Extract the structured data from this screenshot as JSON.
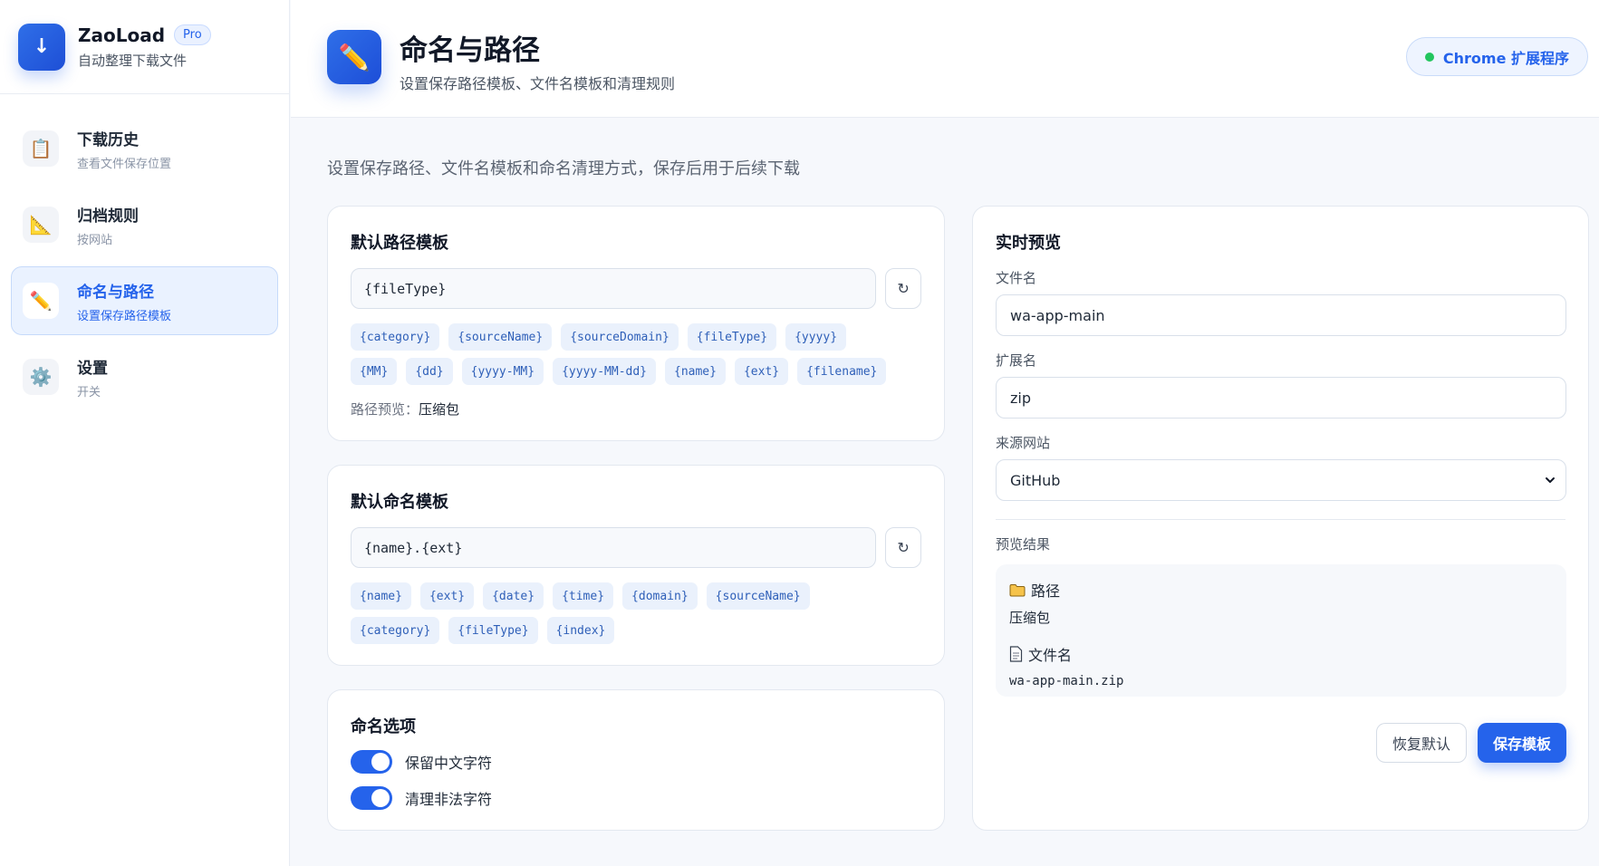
{
  "brand": {
    "name": "ZaoLoad",
    "badge": "Pro",
    "subtitle": "自动整理下载文件",
    "logo_glyph": "↓"
  },
  "sidebar": {
    "items": [
      {
        "label": "下载历史",
        "sub": "查看文件保存位置",
        "icon": "clipboard-icon",
        "glyph": "📋"
      },
      {
        "label": "归档规则",
        "sub": "按网站",
        "icon": "ruler-icon",
        "glyph": "📐"
      },
      {
        "label": "命名与路径",
        "sub": "设置保存路径模板",
        "icon": "pencil-icon",
        "glyph": "✏️"
      },
      {
        "label": "设置",
        "sub": "开关",
        "icon": "gear-icon",
        "glyph": "⚙️"
      }
    ]
  },
  "header": {
    "title": "命名与路径",
    "subtitle": "设置保存路径模板、文件名模板和清理规则",
    "icon": "pencil-icon",
    "icon_glyph": "✏️",
    "extension_label": "Chrome 扩展程序"
  },
  "intro": "设置保存路径、文件名模板和命名清理方式，保存后用于后续下载",
  "path_template": {
    "title": "默认路径模板",
    "value": "{fileType}",
    "chips": [
      "{category}",
      "{sourceName}",
      "{sourceDomain}",
      "{fileType}",
      "{yyyy}",
      "{MM}",
      "{dd}",
      "{yyyy-MM}",
      "{yyyy-MM-dd}",
      "{name}",
      "{ext}",
      "{filename}"
    ],
    "preview_label": "路径预览：",
    "preview_value": "压缩包"
  },
  "name_template": {
    "title": "默认命名模板",
    "value": "{name}.{ext}",
    "chips": [
      "{name}",
      "{ext}",
      "{date}",
      "{time}",
      "{domain}",
      "{sourceName}",
      "{category}",
      "{fileType}",
      "{index}"
    ]
  },
  "options": {
    "title": "命名选项",
    "keep_chinese": "保留中文字符",
    "clean_illegal": "清理非法字符"
  },
  "preview": {
    "title": "实时预览",
    "filename_label": "文件名",
    "filename_value": "wa-app-main",
    "ext_label": "扩展名",
    "ext_value": "zip",
    "source_label": "来源网站",
    "source_value": "GitHub",
    "result_label": "预览结果",
    "path_heading": "路径",
    "path_value": "压缩包",
    "file_heading": "文件名",
    "file_value": "wa-app-main.zip",
    "reset_label": "恢复默认",
    "save_label": "保存模板"
  },
  "colors": {
    "accent": "#2563eb",
    "status_ok": "#22c55e",
    "chip_bg": "#eaf1fc"
  }
}
